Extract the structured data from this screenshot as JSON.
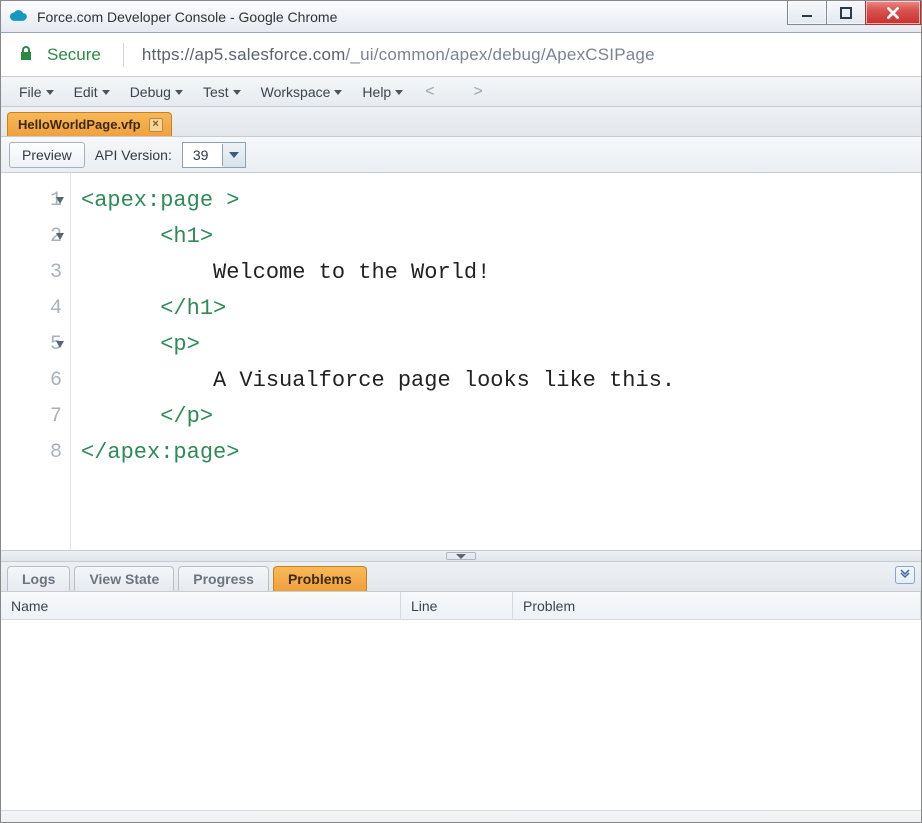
{
  "window": {
    "title": "Force.com Developer Console - Google Chrome"
  },
  "address": {
    "secure_label": "Secure",
    "url_host": "https://ap5.salesforce.com",
    "url_path": "/_ui/common/apex/debug/ApexCSIPage"
  },
  "menubar": {
    "items": [
      "File",
      "Edit",
      "Debug",
      "Test",
      "Workspace",
      "Help"
    ]
  },
  "file_tab": {
    "label": "HelloWorldPage.vfp"
  },
  "toolbar": {
    "preview_label": "Preview",
    "api_label": "API Version:",
    "api_version": "39"
  },
  "editor": {
    "lines": [
      {
        "n": 1,
        "foldable": true,
        "tokens": [
          [
            "tag",
            "<apex:page >"
          ]
        ]
      },
      {
        "n": 2,
        "foldable": true,
        "tokens": [
          [
            "text",
            "      "
          ],
          [
            "tag",
            "<h1>"
          ]
        ]
      },
      {
        "n": 3,
        "foldable": false,
        "tokens": [
          [
            "text",
            "          Welcome to the World!"
          ]
        ]
      },
      {
        "n": 4,
        "foldable": false,
        "tokens": [
          [
            "text",
            "      "
          ],
          [
            "tag",
            "</h1>"
          ]
        ]
      },
      {
        "n": 5,
        "foldable": true,
        "tokens": [
          [
            "text",
            "      "
          ],
          [
            "tag",
            "<p>"
          ]
        ]
      },
      {
        "n": 6,
        "foldable": false,
        "tokens": [
          [
            "text",
            "          A Visualforce page looks like this."
          ]
        ]
      },
      {
        "n": 7,
        "foldable": false,
        "tokens": [
          [
            "text",
            "      "
          ],
          [
            "tag",
            "</p>"
          ]
        ]
      },
      {
        "n": 8,
        "foldable": false,
        "tokens": [
          [
            "tag",
            "</apex:page>"
          ]
        ]
      }
    ]
  },
  "bottom_tabs": {
    "items": [
      "Logs",
      "View State",
      "Progress",
      "Problems"
    ],
    "active_index": 3
  },
  "grid": {
    "col_name": "Name",
    "col_line": "Line",
    "col_problem": "Problem"
  }
}
